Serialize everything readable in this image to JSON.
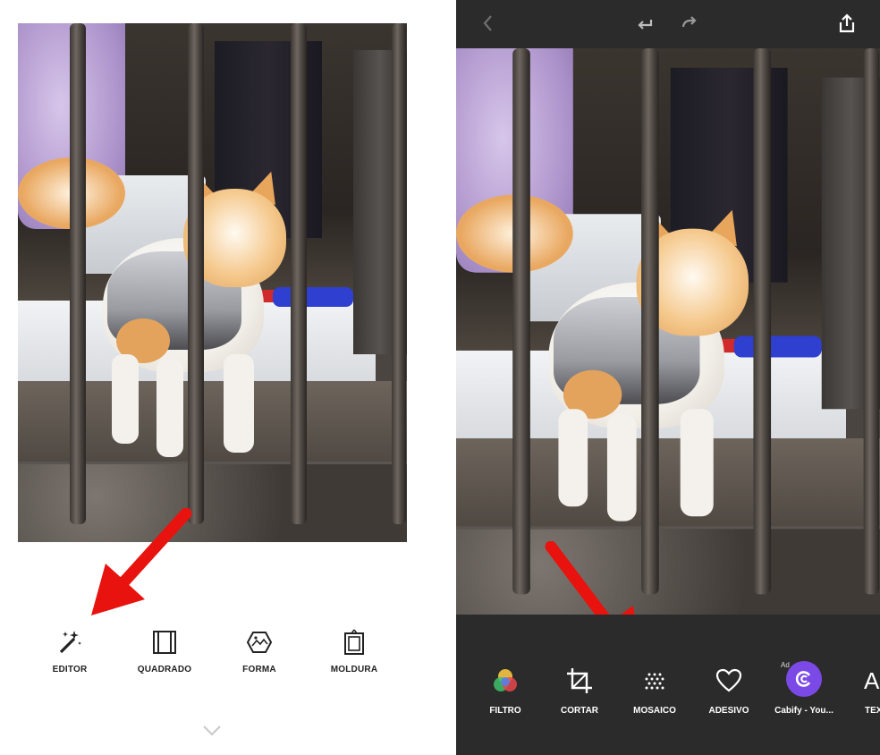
{
  "left_panel": {
    "toolbar": [
      {
        "label": "EDITOR",
        "icon": "magic-wand-icon"
      },
      {
        "label": "QUADRADO",
        "icon": "square-frame-icon"
      },
      {
        "label": "FORMA",
        "icon": "shape-icon"
      },
      {
        "label": "MOLDURA",
        "icon": "frame-icon"
      }
    ],
    "bottom_icon": "chevron-down-icon",
    "arrow_color": "#e8130e"
  },
  "right_panel": {
    "topbar": {
      "back_icon": "back-icon",
      "undo_icon": "undo-icon",
      "redo_icon": "redo-icon",
      "share_icon": "share-icon"
    },
    "toolbar": [
      {
        "label": "FILTRO",
        "icon": "filter-icon"
      },
      {
        "label": "CORTAR",
        "icon": "crop-icon"
      },
      {
        "label": "MOSAICO",
        "icon": "mosaic-icon"
      },
      {
        "label": "ADESIVO",
        "icon": "heart-icon"
      },
      {
        "label": "Cabify - You...",
        "icon": "cabify-icon",
        "ad_tag": "Ad"
      },
      {
        "label": "TEX",
        "icon": "text-icon",
        "glyph": "A"
      }
    ],
    "background_color": "#2b2b2b",
    "arrow_color": "#e8130e"
  }
}
